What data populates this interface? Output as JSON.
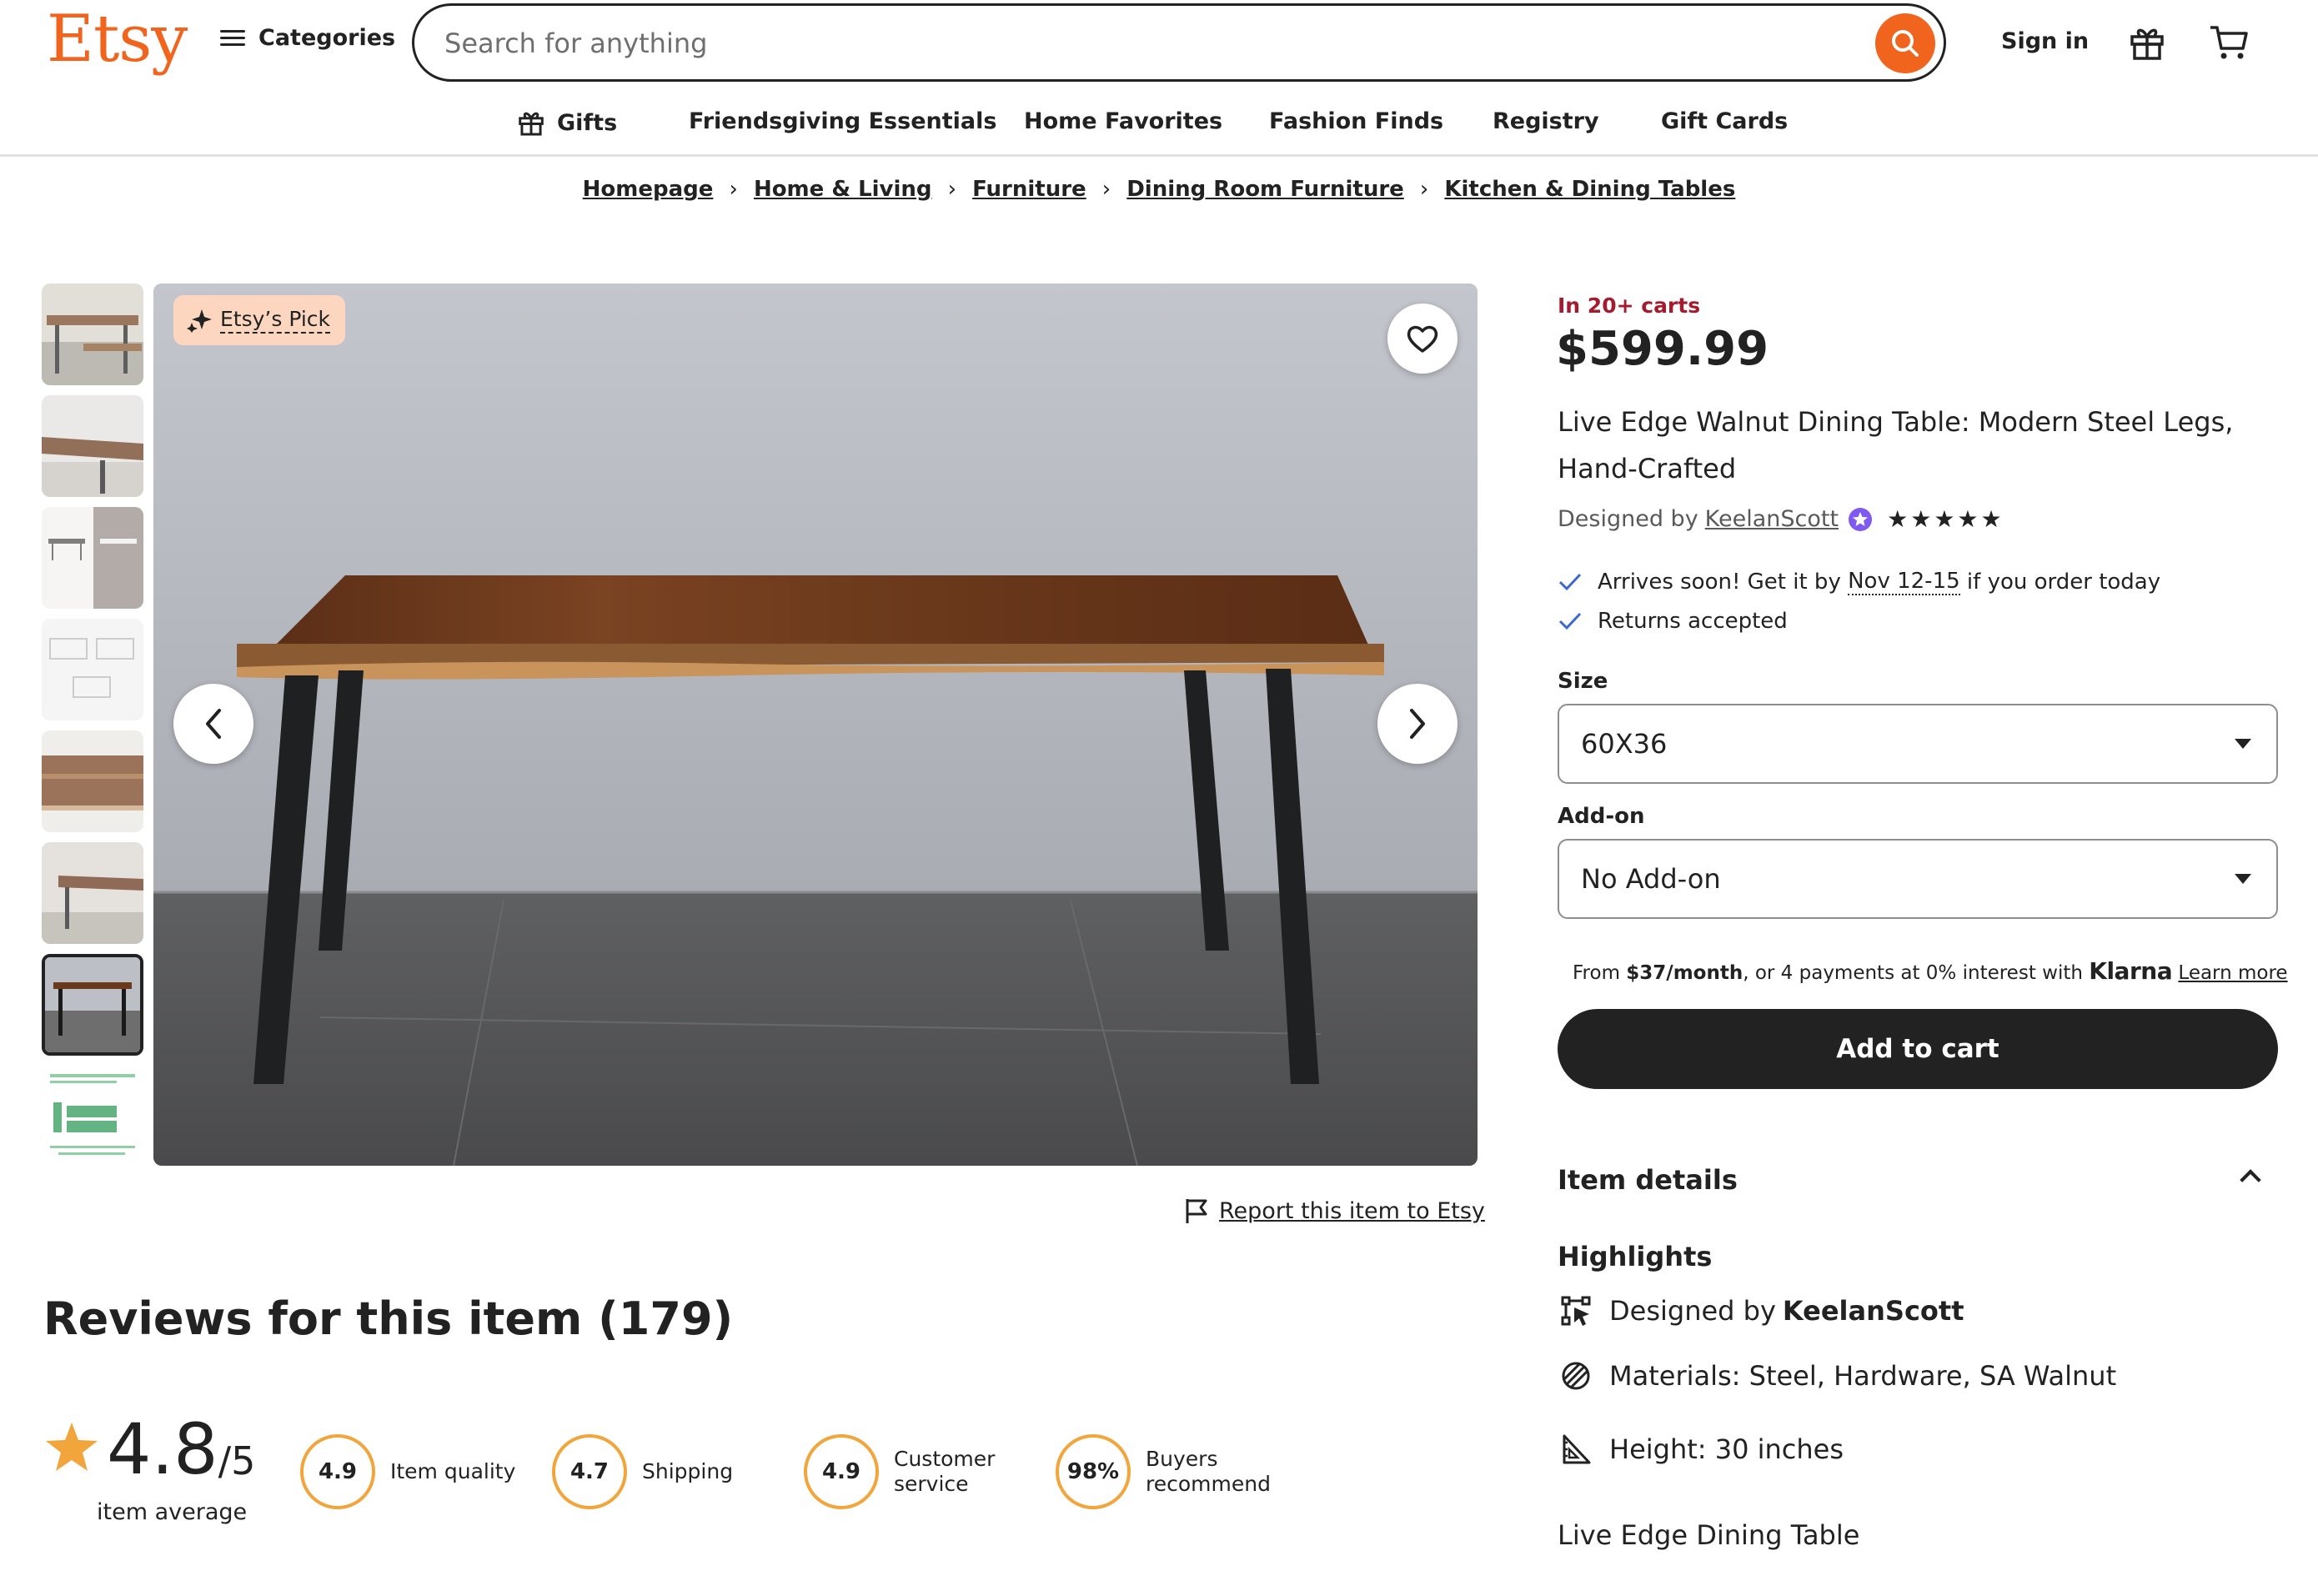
{
  "header": {
    "logo": "Etsy",
    "categories_label": "Categories",
    "search_placeholder": "Search for anything",
    "sign_in": "Sign in"
  },
  "nav": {
    "items": [
      "Gifts",
      "Friendsgiving Essentials",
      "Home Favorites",
      "Fashion Finds",
      "Registry",
      "Gift Cards"
    ]
  },
  "breadcrumb": [
    "Homepage",
    "Home & Living",
    "Furniture",
    "Dining Room Furniture",
    "Kitchen & Dining Tables"
  ],
  "gallery": {
    "badge": "Etsy’s Pick",
    "thumb_count": 8,
    "active_thumb": 7
  },
  "report_link": "Report this item to Etsy",
  "reviews": {
    "title": "Reviews for this item (179)",
    "average": "4.8",
    "average_suffix": "/5",
    "average_label": "item average",
    "metrics": [
      {
        "value": "4.9",
        "label_1": "Item quality",
        "label_2": ""
      },
      {
        "value": "4.7",
        "label_1": "Shipping",
        "label_2": ""
      },
      {
        "value": "4.9",
        "label_1": "Customer",
        "label_2": "service"
      },
      {
        "value": "98%",
        "label_1": "Buyers",
        "label_2": "recommend"
      }
    ]
  },
  "product": {
    "in_carts": "In 20+ carts",
    "price": "$599.99",
    "title": "Live Edge Walnut Dining Table: Modern Steel Legs, Hand-Crafted",
    "designed_by_prefix": "Designed by",
    "shop_name": "KeelanScott",
    "star_rating": 5,
    "delivery_prefix": "Arrives soon! Get it by",
    "delivery_dates": "Nov 12-15",
    "delivery_suffix": "if you order today",
    "returns": "Returns accepted",
    "size_label": "Size",
    "size_value": "60X36",
    "addon_label": "Add-on",
    "addon_value": "No Add-on",
    "klarna": {
      "prefix": "From",
      "monthly": "$37/month",
      "middle": ", or 4 payments at 0% interest with",
      "brand": "Klarna",
      "learn_more": "Learn more"
    },
    "add_to_cart": "Add to cart",
    "item_details": "Item details",
    "highlights_title": "Highlights",
    "highlights": {
      "designed_prefix": "Designed by",
      "designed_shop": "KeelanScott",
      "materials": "Materials: Steel, Hardware, SA Walnut",
      "height": "Height: 30 inches"
    },
    "subtitle": "Live Edge Dining Table"
  },
  "colors": {
    "brand_orange": "#f1641e",
    "cart_red": "#a61a2e",
    "rating_ring": "#f1a53b",
    "star_orange": "#f1a53b",
    "button_dark": "#222222",
    "badge_peach": "#fdd6bf"
  }
}
